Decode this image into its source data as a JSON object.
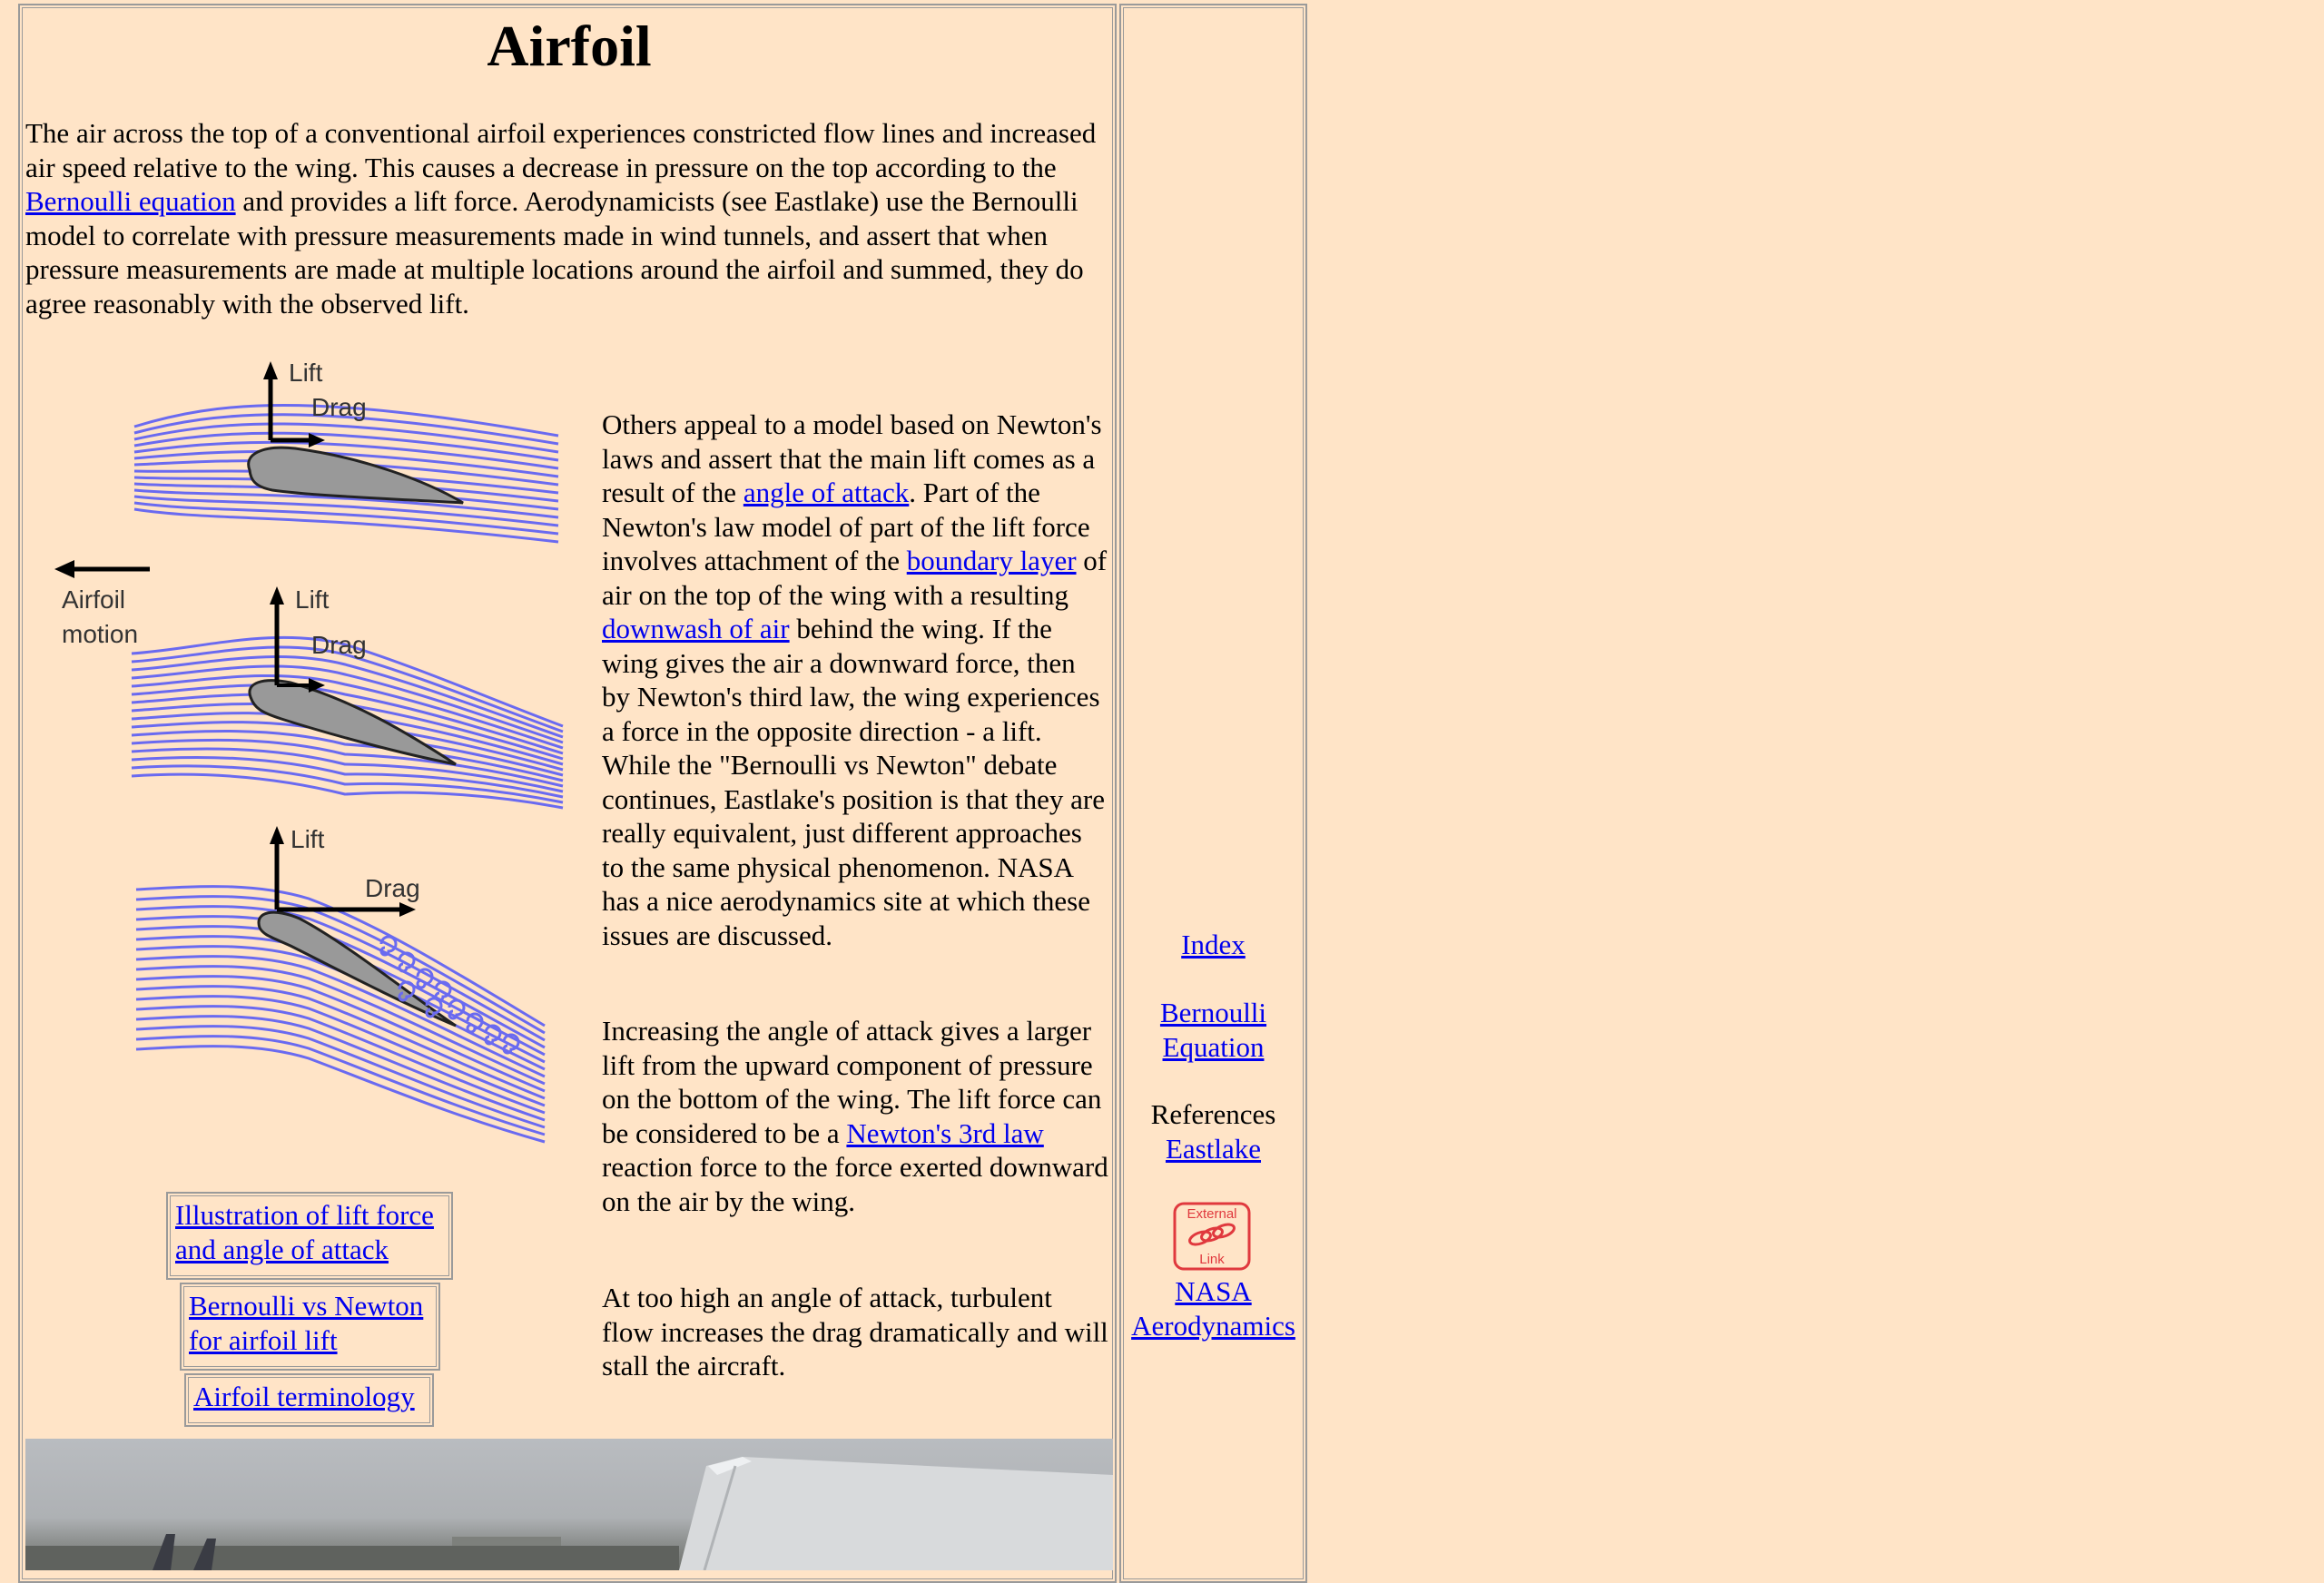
{
  "title": "Airfoil",
  "intro": {
    "before_link": "The air across the top of a conventional airfoil experiences constricted flow lines and increased air speed relative to the wing. This causes a decrease in pressure on the top according to the ",
    "link": "Bernoulli equation",
    "after_link": " and provides a lift force. Aerodynamicists (see Eastlake) use the Bernoulli model to correlate with pressure measurements made in wind tunnels, and assert that when pressure measurements are made at multiple locations around the airfoil and summed, they do agree reasonably with the observed lift."
  },
  "diagram": {
    "lift_label": "Lift",
    "drag_label": "Drag",
    "motion_label_line1": "Airfoil",
    "motion_label_line2": "motion",
    "flow_color": "#6a6af0",
    "airfoil_color": "#999999"
  },
  "para1": {
    "t1": "Others appeal to a model based on Newton's laws and assert that the main lift comes as a result of the ",
    "l1": "angle of attack",
    "t2": ". Part of the Newton's law model of part of the lift force involves attachment of the ",
    "l2": "boundary layer",
    "t3": " of air on the top of the wing with a resulting ",
    "l3": "downwash of air",
    "t4": " behind the wing. If the wing gives the air a downward force, then by Newton's third law, the wing experiences a force in the opposite direction - a lift. While the \"Bernoulli vs Newton\" debate continues, Eastlake's position is that they are really equivalent, just different approaches to the same physical phenomenon. NASA has a nice aerodynamics site at which these issues are discussed."
  },
  "para2": {
    "t1": "Increasing the angle of attack gives a larger lift from the upward component of pressure on the bottom of the wing. The lift force can be considered to be a ",
    "l1": "Newton's 3rd law",
    "t2": " reaction force to the force exerted downward on the air by the wing."
  },
  "para3": "At too high an angle of attack, turbulent flow increases the drag dramatically and will stall the aircraft.",
  "link_boxes": [
    "Illustration of lift force and angle of attack",
    "Bernoulli vs Newton for airfoil lift",
    "Airfoil terminology"
  ],
  "sidebar": {
    "index": "Index",
    "bernoulli": "Bernoulli Equation",
    "references": "References",
    "eastlake": "Eastlake",
    "ext_line1": "External",
    "ext_line2": "Link",
    "nasa": "NASA Aerodynamics",
    "ext_color": "#e0393e"
  }
}
